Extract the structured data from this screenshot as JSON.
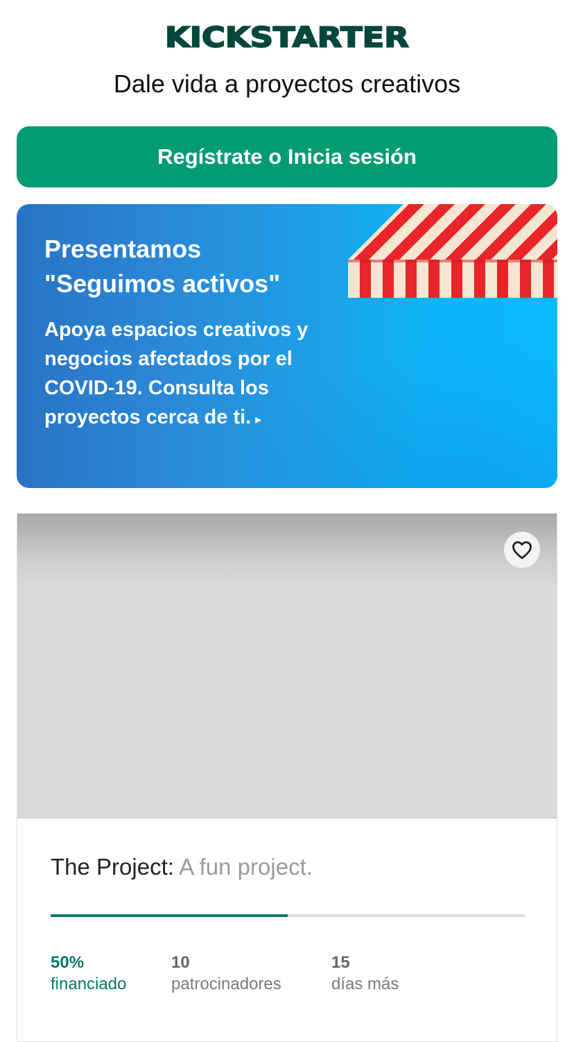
{
  "header": {
    "logo_text": "KICKSTARTER",
    "tagline": "Dale vida a proyectos creativos"
  },
  "cta": {
    "label": "Regístrate o Inicia sesión"
  },
  "banner": {
    "title_line1": "Presentamos",
    "title_line2": "\"Seguimos activos\"",
    "body": "Apoya espacios creativos y negocios afectados por el COVID-19. Consulta los proyectos cerca de ti.",
    "arrow": "▸"
  },
  "project_card": {
    "title": "The Project:",
    "blurb": "A fun project.",
    "progress_percent": 50,
    "favorite_icon": "heart-outline-icon",
    "stats": {
      "funded_value": "50%",
      "funded_label": "financiado",
      "backers_value": "10",
      "backers_label": "patrocinadores",
      "days_value": "15",
      "days_label": "días más"
    }
  },
  "colors": {
    "brand_dark": "#05473c",
    "cta_green": "#039b71",
    "progress_green": "#087865"
  }
}
